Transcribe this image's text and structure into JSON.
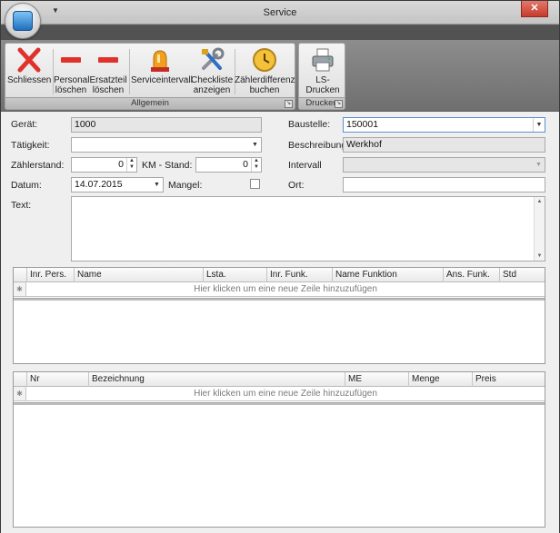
{
  "window": {
    "title": "Service",
    "close": "✕"
  },
  "ribbon": {
    "groups": [
      {
        "label": "Allgemein"
      },
      {
        "label": "Drucken"
      }
    ],
    "buttons": {
      "schliessen": "Schliessen",
      "personal_loeschen_1": "Personal",
      "personal_loeschen_2": "löschen",
      "ersatzteil_loeschen_1": "Ersatzteil",
      "ersatzteil_loeschen_2": "löschen",
      "serviceintervall": "Serviceintervall",
      "checkliste_1": "Checkliste",
      "checkliste_2": "anzeigen",
      "zaehlerdifferenz_1": "Zählerdifferenz",
      "zaehlerdifferenz_2": "buchen",
      "ls_drucken": "LS-Drucken"
    }
  },
  "form": {
    "geraet_label": "Gerät:",
    "geraet_value": "1000",
    "taetigkeit_label": "Tätigkeit:",
    "taetigkeit_value": "",
    "zaehlerstand_label": "Zählerstand:",
    "zaehlerstand_value": "0",
    "km_stand_label": "KM - Stand:",
    "km_stand_value": "0",
    "datum_label": "Datum:",
    "datum_value": "14.07.2015",
    "mangel_label": "Mangel:",
    "mangel_checked": false,
    "text_label": "Text:",
    "baustelle_label": "Baustelle:",
    "baustelle_value": "150001",
    "beschreibung_label": "Beschreibung",
    "beschreibung_value": "Werkhof",
    "intervall_label": "Intervall",
    "intervall_value": "",
    "ort_label": "Ort:",
    "ort_value": ""
  },
  "grid1": {
    "columns": [
      "Inr. Pers.",
      "Name",
      "Lsta.",
      "Inr. Funk.",
      "Name Funktion",
      "Ans. Funk.",
      "Std"
    ],
    "new_row_text": "Hier klicken um eine neue Zeile hinzuzufügen"
  },
  "grid2": {
    "columns": [
      "Nr",
      "Bezeichnung",
      "ME",
      "Menge",
      "Preis"
    ],
    "new_row_text": "Hier klicken um eine neue Zeile hinzuzufügen"
  },
  "colors": {
    "accent_blue": "#1e6fbf",
    "close_red": "#c43c2c",
    "delete_red": "#e0312b",
    "alarm_orange": "#f0a020"
  },
  "icons": [
    "app-orb-icon",
    "close-x-icon",
    "minus-icon",
    "alarm-light-icon",
    "tools-icon",
    "clock-icon",
    "printer-icon",
    "chevron-down-icon",
    "spin-arrows-icon"
  ]
}
